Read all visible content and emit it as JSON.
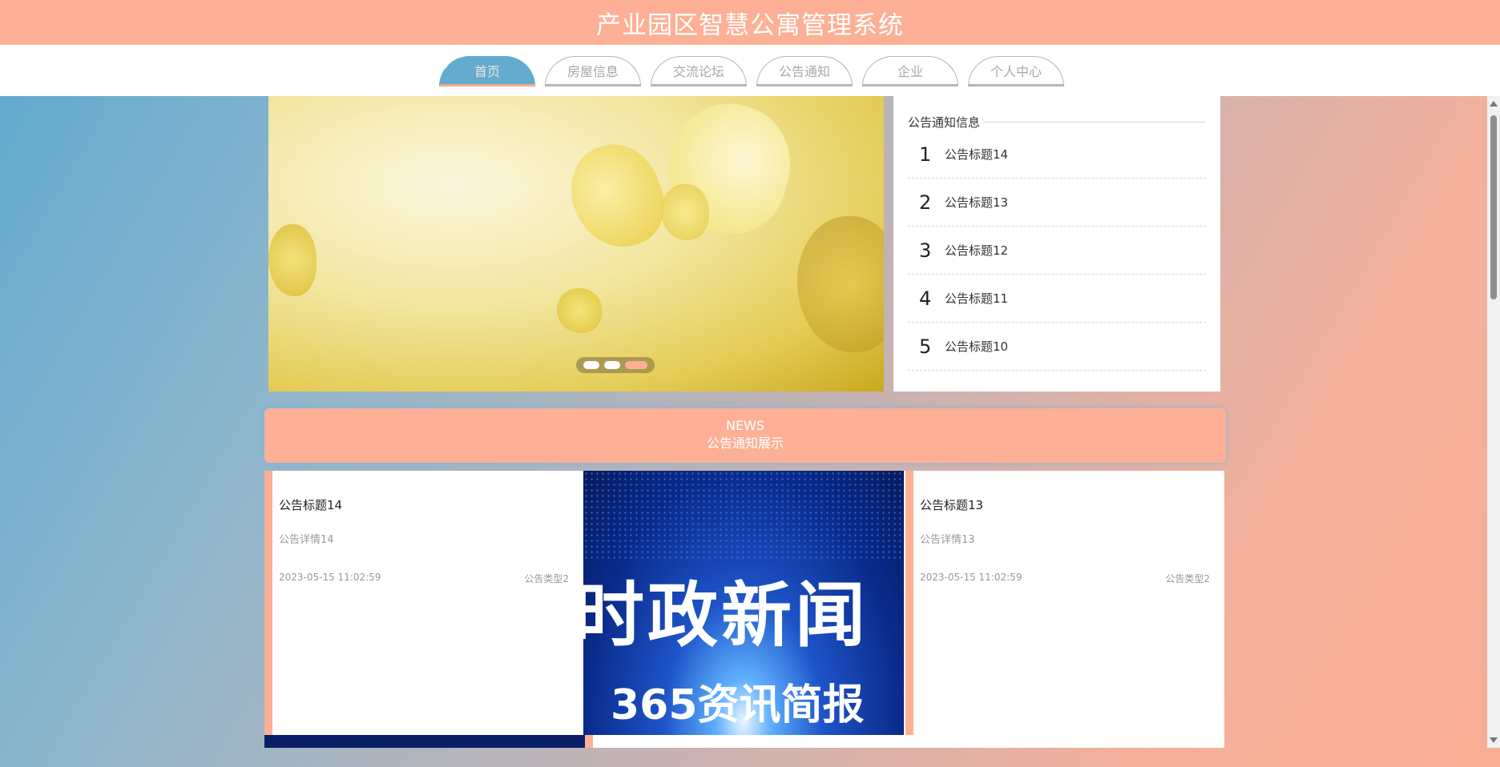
{
  "app": {
    "title": "产业园区智慧公寓管理系统"
  },
  "nav": {
    "tabs": [
      {
        "label": "首页",
        "active": true
      },
      {
        "label": "房屋信息",
        "active": false
      },
      {
        "label": "交流论坛",
        "active": false
      },
      {
        "label": "公告通知",
        "active": false
      },
      {
        "label": "企业",
        "active": false
      },
      {
        "label": "个人中心",
        "active": false
      }
    ]
  },
  "banner": {
    "slides": 3,
    "active_slide": 3
  },
  "notice_panel": {
    "heading": "公告通知信息",
    "items": [
      {
        "num": "1",
        "title": "公告标题14"
      },
      {
        "num": "2",
        "title": "公告标题13"
      },
      {
        "num": "3",
        "title": "公告标题12"
      },
      {
        "num": "4",
        "title": "公告标题11"
      },
      {
        "num": "5",
        "title": "公告标题10"
      }
    ]
  },
  "news": {
    "label_en": "NEWS",
    "label_cn": "公告通知展示",
    "cards": [
      {
        "title": "公告标题14",
        "desc": "公告详情14",
        "date": "2023-05-15 11:02:59",
        "type": "公告类型2"
      },
      {
        "title": "公告标题13",
        "desc": "公告详情13",
        "date": "2023-05-15 11:02:59",
        "type": "公告类型2"
      }
    ],
    "image": {
      "headline": "时政新闻",
      "subline": "365资讯简报"
    }
  },
  "colors": {
    "accent": "#fdb096",
    "active_tab": "#63acd0"
  }
}
